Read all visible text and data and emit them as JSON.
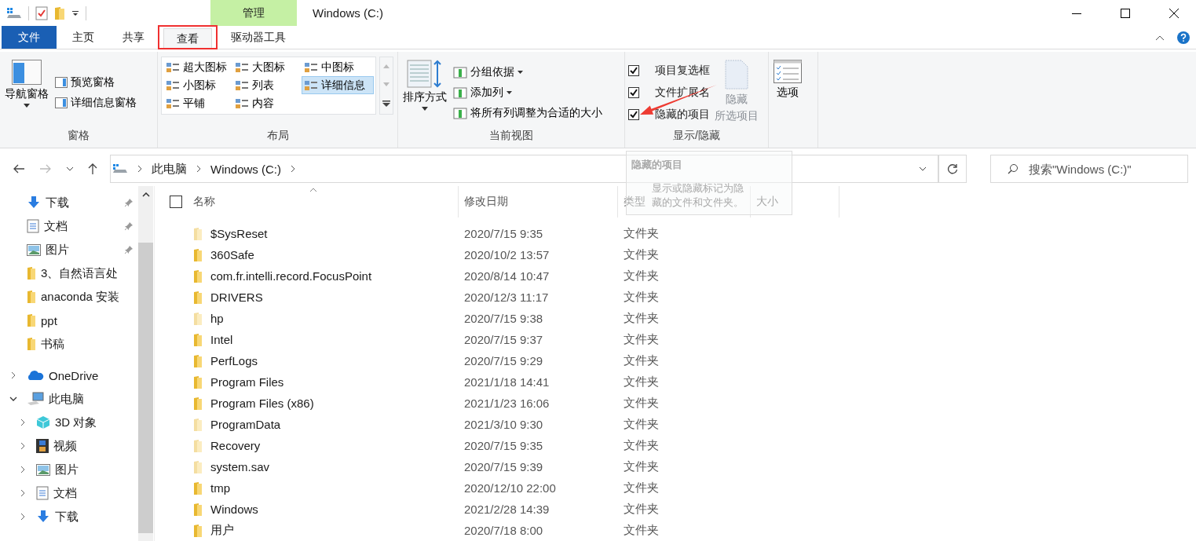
{
  "window": {
    "title": "Windows (C:)",
    "context_tab": "管理"
  },
  "tabs": [
    {
      "label": "文件",
      "kind": "file",
      "selected": false,
      "highlighted": false
    },
    {
      "label": "主页",
      "kind": "tab",
      "selected": false,
      "highlighted": false
    },
    {
      "label": "共享",
      "kind": "tab",
      "selected": false,
      "highlighted": false
    },
    {
      "label": "查看",
      "kind": "tab",
      "selected": true,
      "highlighted": true
    },
    {
      "label": "驱动器工具",
      "kind": "tab",
      "selected": false,
      "highlighted": false
    }
  ],
  "ribbon": {
    "panes": {
      "big": "导航窗格",
      "items": [
        "预览窗格",
        "详细信息窗格"
      ],
      "label": "窗格"
    },
    "layout": {
      "options": [
        {
          "label": "超大图标",
          "selected": false
        },
        {
          "label": "大图标",
          "selected": false
        },
        {
          "label": "中图标",
          "selected": false
        },
        {
          "label": "小图标",
          "selected": false
        },
        {
          "label": "列表",
          "selected": false
        },
        {
          "label": "详细信息",
          "selected": true
        },
        {
          "label": "平铺",
          "selected": false
        },
        {
          "label": "内容",
          "selected": false
        }
      ],
      "label": "布局"
    },
    "current_view": {
      "big": "排序方式",
      "items": [
        {
          "label": "分组依据",
          "dropdown": true
        },
        {
          "label": "添加列",
          "dropdown": true
        },
        {
          "label": "将所有列调整为合适的大小",
          "dropdown": false
        }
      ],
      "label": "当前视图"
    },
    "show_hide": {
      "checkboxes": [
        {
          "label": "项目复选框",
          "checked": true
        },
        {
          "label": "文件扩展名",
          "checked": true
        },
        {
          "label": "隐藏的项目",
          "checked": true
        }
      ],
      "hide_button": {
        "line1": "隐藏",
        "line2": "所选项目",
        "disabled": true
      },
      "label": "显示/隐藏"
    },
    "options": "选项"
  },
  "address": {
    "path": [
      "此电脑",
      "Windows (C:)"
    ],
    "search_placeholder": "搜索\"Windows (C:)\""
  },
  "tooltip": {
    "title": "隐藏的项目",
    "text": "显示或隐藏标记为隐藏的文件和文件夹。"
  },
  "nav": [
    {
      "label": "下载",
      "kind": "downloads",
      "pinned": true
    },
    {
      "label": "文档",
      "kind": "documents",
      "pinned": true
    },
    {
      "label": "图片",
      "kind": "pictures",
      "pinned": true
    },
    {
      "label": "3、自然语言处",
      "kind": "folder",
      "pinned": false
    },
    {
      "label": "anaconda 安装",
      "kind": "folder",
      "pinned": false
    },
    {
      "label": "ppt",
      "kind": "folder",
      "pinned": false
    },
    {
      "label": "书稿",
      "kind": "folder",
      "pinned": false
    },
    {
      "label": "OneDrive",
      "kind": "cloud",
      "pinned": false,
      "expanded": false
    },
    {
      "label": "此电脑",
      "kind": "computer",
      "pinned": false,
      "expanded": true,
      "children": [
        {
          "label": "3D 对象",
          "kind": "objects3d",
          "expanded": false
        },
        {
          "label": "视频",
          "kind": "videos",
          "expanded": false
        },
        {
          "label": "图片",
          "kind": "pictures",
          "expanded": false
        },
        {
          "label": "文档",
          "kind": "documents",
          "expanded": false
        },
        {
          "label": "下载",
          "kind": "downloads",
          "expanded": false
        }
      ]
    }
  ],
  "table": {
    "select_all": {
      "checked": false
    },
    "columns": [
      "名称",
      "修改日期",
      "类型",
      "大小"
    ],
    "rows": [
      {
        "name": "$SysReset",
        "date": "2020/7/15 9:35",
        "type": "文件夹",
        "hidden": true
      },
      {
        "name": "360Safe",
        "date": "2020/10/2 13:57",
        "type": "文件夹",
        "hidden": false
      },
      {
        "name": "com.fr.intelli.record.FocusPoint",
        "date": "2020/8/14 10:47",
        "type": "文件夹",
        "hidden": false
      },
      {
        "name": "DRIVERS",
        "date": "2020/12/3 11:17",
        "type": "文件夹",
        "hidden": false
      },
      {
        "name": "hp",
        "date": "2020/7/15 9:38",
        "type": "文件夹",
        "hidden": true
      },
      {
        "name": "Intel",
        "date": "2020/7/15 9:37",
        "type": "文件夹",
        "hidden": false
      },
      {
        "name": "PerfLogs",
        "date": "2020/7/15 9:29",
        "type": "文件夹",
        "hidden": false
      },
      {
        "name": "Program Files",
        "date": "2021/1/18 14:41",
        "type": "文件夹",
        "hidden": false
      },
      {
        "name": "Program Files (x86)",
        "date": "2021/1/23 16:06",
        "type": "文件夹",
        "hidden": false
      },
      {
        "name": "ProgramData",
        "date": "2021/3/10 9:30",
        "type": "文件夹",
        "hidden": true
      },
      {
        "name": "Recovery",
        "date": "2020/7/15 9:35",
        "type": "文件夹",
        "hidden": true
      },
      {
        "name": "system.sav",
        "date": "2020/7/15 9:39",
        "type": "文件夹",
        "hidden": true
      },
      {
        "name": "tmp",
        "date": "2020/12/10 22:00",
        "type": "文件夹",
        "hidden": false
      },
      {
        "name": "Windows",
        "date": "2021/2/28 14:39",
        "type": "文件夹",
        "hidden": false
      },
      {
        "name": "用户",
        "date": "2020/7/18 8:00",
        "type": "文件夹",
        "hidden": false
      }
    ]
  }
}
